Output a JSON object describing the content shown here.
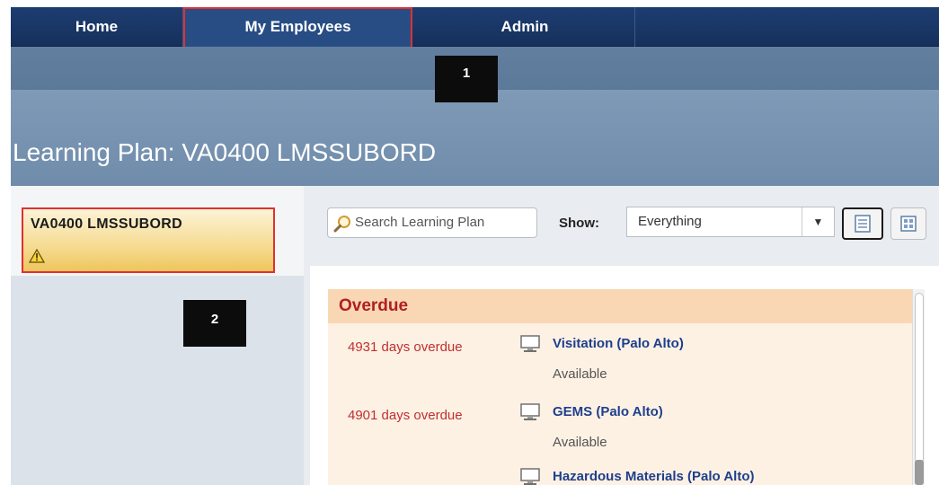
{
  "nav": {
    "home": "Home",
    "my_employees": "My Employees",
    "admin": "Admin"
  },
  "markers": {
    "m1": "1",
    "m2": "2"
  },
  "page_title": "Learning Plan: VA0400 LMSSUBORD",
  "employee": {
    "name": "VA0400  LMSSUBORD",
    "warning_icon": "warning-icon"
  },
  "toolbar": {
    "search_placeholder": "Search Learning Plan",
    "show_label": "Show:",
    "show_value": "Everything"
  },
  "overdue": {
    "title": "Overdue",
    "items": [
      {
        "days": "4931 days overdue",
        "title": "Visitation (Palo Alto)",
        "status": "Available",
        "icon": "monitor-icon"
      },
      {
        "days": "4901 days overdue",
        "title": "GEMS (Palo Alto)",
        "status": "Available",
        "icon": "monitor-icon"
      },
      {
        "days": "",
        "title": "Hazardous Materials (Palo Alto)",
        "status": "",
        "icon": "monitor-icon"
      }
    ]
  },
  "colors": {
    "nav_bg": "#1d3d70",
    "overdue_text": "#c03030",
    "link": "#1f3f8c",
    "highlight": "#e03030"
  }
}
